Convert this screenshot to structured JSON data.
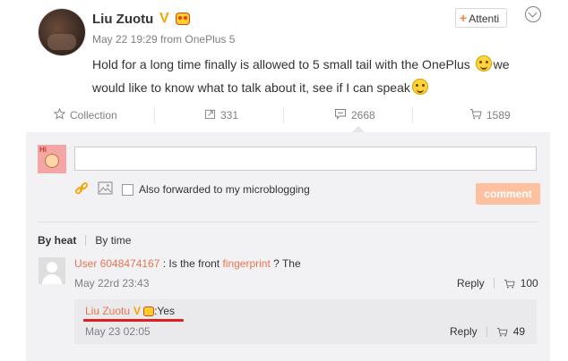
{
  "post": {
    "username": "Liu Zuotu",
    "verified_badge": "V",
    "timestamp_source": "May 22 19:29 from OnePlus 5",
    "text_part1": "Hold for a long time finally is allowed to 5 small tail with the OnePlus ",
    "text_part2": "we would like to know what to talk about it, see if I can speak",
    "follow_label": "Attenti",
    "icons": [
      "avatar",
      "verified-badge",
      "fan-badge-icon",
      "smile-emoji-icon",
      "thinking-emoji-icon",
      "follow-plus-icon",
      "chevron-down-icon"
    ]
  },
  "actions": {
    "collection_label": "Collection",
    "repost_count": "331",
    "comment_count": "2668",
    "like_count": "1589"
  },
  "composer": {
    "placeholder": "",
    "forward_label": "Also forwarded to my microblogging",
    "comment_button": "comment"
  },
  "sort": {
    "by_heat": "By heat",
    "by_time": "By time"
  },
  "comments": [
    {
      "user": "User 6048474167",
      "text_before": " : Is the front ",
      "highlight": "fingerprint",
      "text_after": " ? The",
      "time": "May 22rd 23:43",
      "reply_label": "Reply",
      "likes": "100"
    }
  ],
  "replies": [
    {
      "user": "Liu Zuotu",
      "badge": "V",
      "text": ":Yes",
      "time": "May 23 02:05",
      "reply_label": "Reply",
      "likes": "49"
    }
  ],
  "colors": {
    "accent_orange": "#eb7350",
    "comment_button_bg": "#ffc09f",
    "verified_gold": "#f6a500",
    "underline_red": "#e02020"
  }
}
